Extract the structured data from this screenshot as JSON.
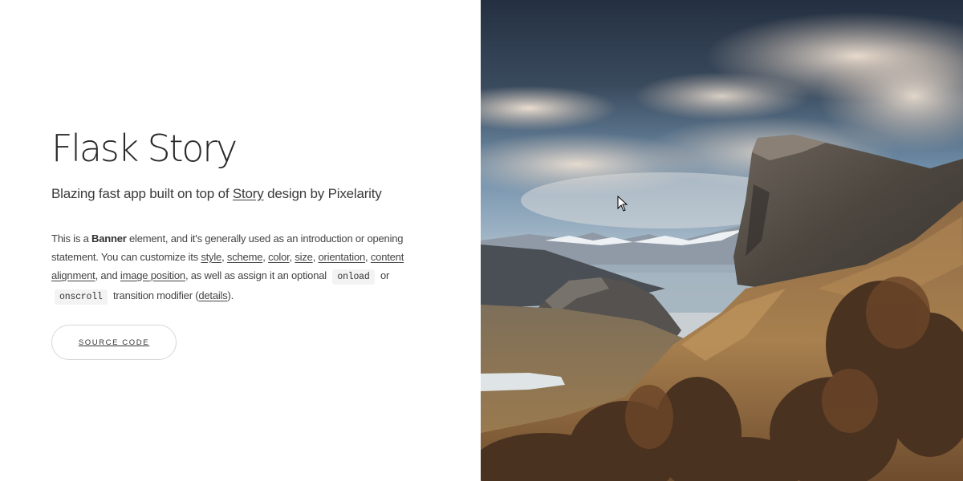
{
  "banner": {
    "title": "Flask Story",
    "subtitle": {
      "before": "Blazing fast app built on top of ",
      "link": "Story",
      "after": " design by Pixelarity"
    },
    "paragraph": {
      "t1": "This is a ",
      "strong": "Banner",
      "t2": " element, and it's generally used as an introduction or opening statement. You can customize its ",
      "link_style": "style",
      "sep1": ", ",
      "link_scheme": "scheme",
      "sep2": ", ",
      "link_color": "color",
      "sep3": ", ",
      "link_size": "size",
      "sep4": ", ",
      "link_orientation": "orientation",
      "sep5": ", ",
      "link_content_alignment": "content alignment",
      "t3": ", and ",
      "link_image_position": "image position",
      "t4": ", as well as assign it an optional ",
      "code_onload": "onload",
      "t5": " or ",
      "code_onscroll": "onscroll",
      "t6": " transition modifier (",
      "link_details": "details",
      "t7": ")."
    },
    "button_label": "SOURCE CODE"
  },
  "image": {
    "icon": "landscape-photo",
    "description_colors": {
      "sky_dark": "#2f3b4c",
      "sky_blue": "#6c8fae",
      "cloud": "#e8d9cc",
      "cliff": "#4a4641",
      "slope": "#a77a4a",
      "valley": "#8a7250"
    }
  },
  "cursor_icon": "mouse-pointer-icon"
}
